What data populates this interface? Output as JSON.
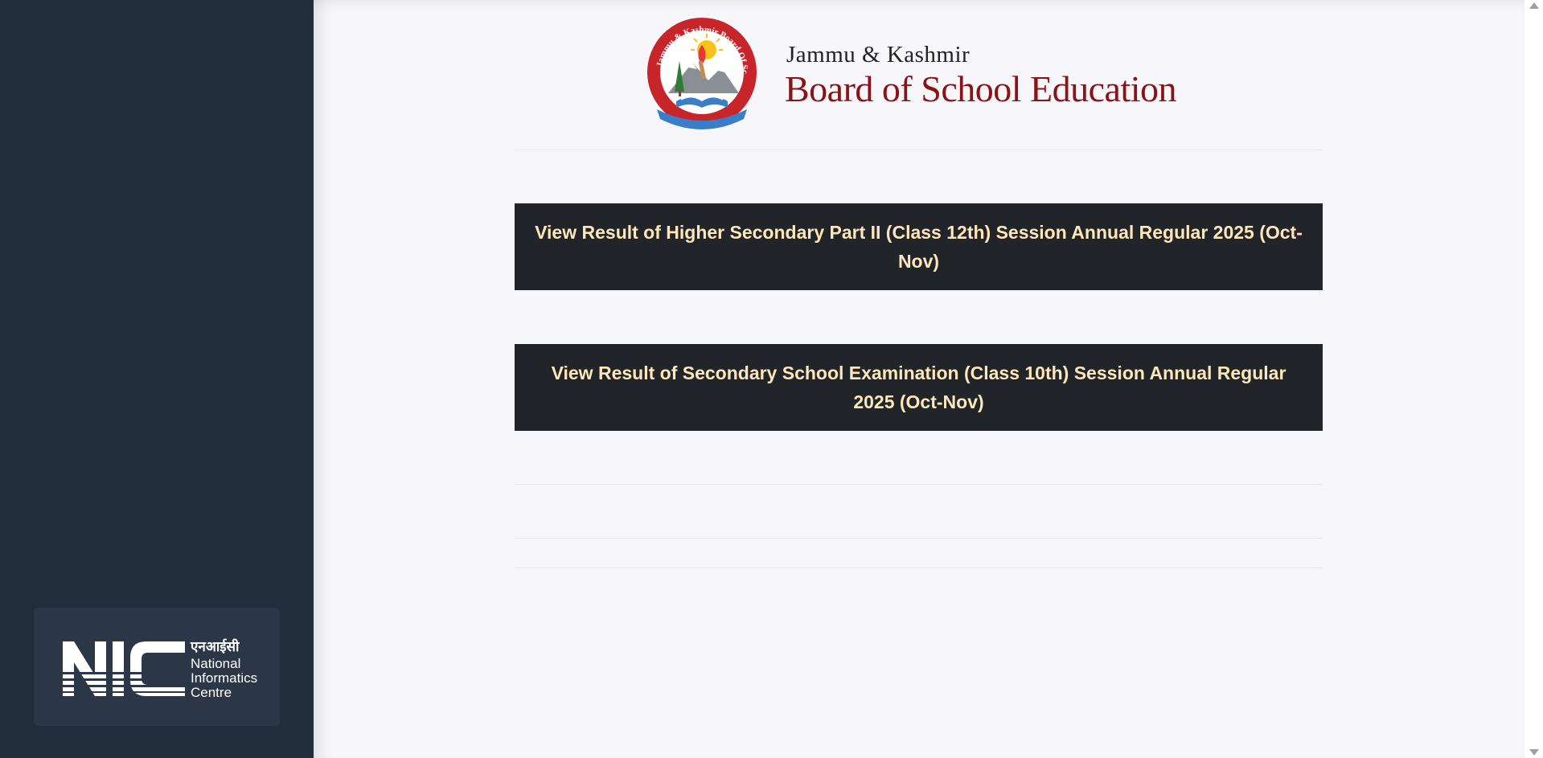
{
  "header": {
    "org_line1": "Jammu & Kashmir",
    "org_line2": "Board of School Education",
    "emblem_text": "Jammu & Kashmir Board Of School Education"
  },
  "results": [
    {
      "label": "View Result of Higher Secondary Part II (Class 12th) Session Annual Regular 2025 (Oct-Nov)"
    },
    {
      "label": "View Result of Secondary School Examination (Class 10th) Session Annual Regular 2025 (Oct-Nov)"
    }
  ],
  "footer_logo": {
    "letters": "NIC",
    "hindi": "एनआईसी",
    "line1": "National",
    "line2": "Informatics",
    "line3": "Centre"
  },
  "colors": {
    "sidebar": "#222d3b",
    "button_bg": "#212429",
    "button_text": "#fde7b8",
    "brand_red": "#8b1215"
  },
  "icons": {
    "emblem": "jkbose-emblem-icon",
    "nic": "nic-logo-icon",
    "scroll_up": "scroll-up-arrow-icon",
    "scroll_down": "scroll-down-arrow-icon"
  }
}
